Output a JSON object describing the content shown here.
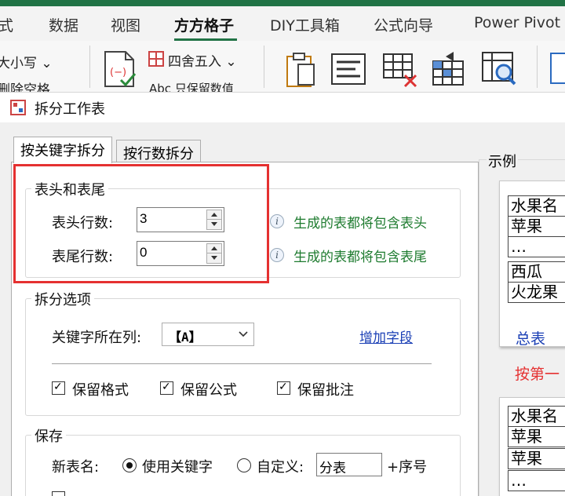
{
  "ribbon": {
    "tabs": [
      "式",
      "数据",
      "视图",
      "方方格子",
      "DIY工具箱",
      "公式向导",
      "Power Pivot"
    ],
    "active_tab": "方方格子",
    "case_button": "大小写",
    "round_button": "四舍五入",
    "cut_label1": "删除空格",
    "cut_label2": "只保留数值",
    "accent_color": "#217346"
  },
  "dialog": {
    "title": "拆分工作表",
    "tabs": [
      "按关键字拆分",
      "按行数拆分"
    ],
    "header_footer": {
      "title": "表头和表尾",
      "header_rows_label": "表头行数:",
      "header_rows_value": "3",
      "footer_rows_label": "表尾行数:",
      "footer_rows_value": "0",
      "header_hint": "生成的表都将包含表头",
      "footer_hint": "生成的表都将包含表尾"
    },
    "split_options": {
      "title": "拆分选项",
      "keyword_col_label": "关键字所在列:",
      "keyword_col_value": "【A】",
      "add_field_link": "增加字段",
      "keep_format": "保留格式",
      "keep_formula": "保留公式",
      "keep_comment": "保留批注"
    },
    "save": {
      "title": "保存",
      "new_name_label": "新表名:",
      "use_keyword": "使用关键字",
      "custom": "自定义:",
      "custom_value": "分表",
      "seq_suffix": "+序号"
    },
    "example": {
      "title": "示例",
      "sheet1_cells": [
        "水果名",
        "苹果",
        "…",
        "西瓜",
        "火龙果"
      ],
      "sheet1_tab": "总表",
      "split_by_label": "按第一",
      "sheet2_cells": [
        "水果名",
        "苹果",
        "苹果",
        "…"
      ]
    }
  }
}
